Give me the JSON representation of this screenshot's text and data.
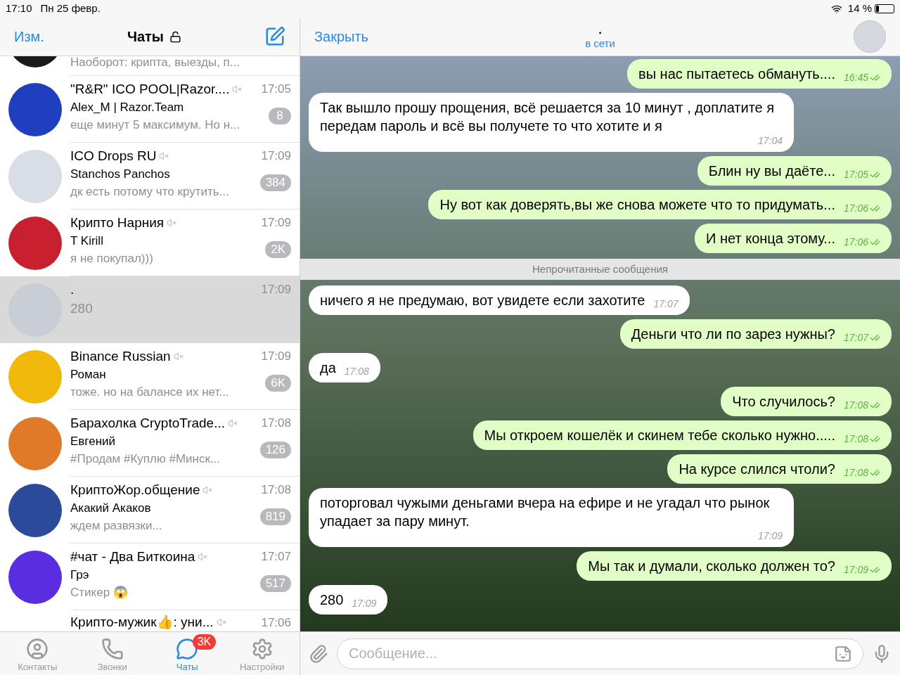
{
  "status_bar": {
    "time": "17:10",
    "date": "Пн 25 февр.",
    "battery": "14 %"
  },
  "chat_list": {
    "edit": "Изм.",
    "title": "Чаты",
    "locked": false,
    "chats": [
      {
        "kind": "top_partial",
        "preview": "Наоборот: крипта, выезды, п...",
        "color": "#1a1a1a"
      },
      {
        "kind": "full",
        "title": "\"R&R\" ICO POOL|Razor....",
        "muted": true,
        "time": "17:05",
        "sender": "Alex_M | Razor.Team",
        "preview": "еще минут 5 максимум. Но н...",
        "badge": "8",
        "selected": false,
        "color": "#1f3fbf"
      },
      {
        "kind": "full",
        "title": "ICO Drops RU",
        "muted": true,
        "time": "17:09",
        "sender": "Stanchos Panchos",
        "preview": "дк есть потому что крутить...",
        "badge": "384",
        "selected": false,
        "color": "#d9dde6"
      },
      {
        "kind": "full",
        "title": "Крипто Нарния",
        "muted": true,
        "time": "17:09",
        "sender": "T Kirill",
        "preview": "я не покупал)))",
        "badge": "2K",
        "selected": false,
        "color": "#c8202e"
      },
      {
        "kind": "full",
        "title": ".",
        "muted": false,
        "time": "17:09",
        "preview": "280",
        "selected": true,
        "color": "#c9ced6"
      },
      {
        "kind": "full",
        "title": "Binance Russian",
        "muted": true,
        "time": "17:09",
        "sender": "Роман",
        "preview": "тоже. но на балансе их нет...",
        "badge": "6K",
        "selected": false,
        "color": "#f0b90b"
      },
      {
        "kind": "full",
        "title": "Барахолка CryptoTrade...",
        "muted": true,
        "time": "17:08",
        "sender": "Евгений",
        "preview": "#Продам #Куплю  #Минск...",
        "badge": "126",
        "selected": false,
        "color": "#e07a28"
      },
      {
        "kind": "full",
        "title": "КриптоЖор.общение",
        "muted": true,
        "time": "17:08",
        "sender": "Акакий Акаков",
        "preview": "ждем развязки...",
        "badge": "819",
        "selected": false,
        "color": "#2b4a9a"
      },
      {
        "kind": "full",
        "title": "#чат - Два Биткоина",
        "muted": true,
        "time": "17:07",
        "sender": "Грэ",
        "preview": "Стикер 😱",
        "badge": "517",
        "selected": false,
        "color": "#5b2de0"
      },
      {
        "kind": "bottom_partial",
        "title": "Крипто-мужик👍: уни...",
        "muted": true,
        "time": "17:06"
      }
    ]
  },
  "tab_bar": [
    {
      "kind": "contacts",
      "label": "Контакты",
      "selected": false
    },
    {
      "kind": "calls",
      "label": "Звонки",
      "selected": false
    },
    {
      "kind": "chats",
      "label": "Чаты",
      "selected": true,
      "badge": "3K"
    },
    {
      "kind": "settings",
      "label": "Настройки",
      "selected": false
    }
  ],
  "chat": {
    "close": "Закрыть",
    "title": ".",
    "status": "в сети",
    "messages": [
      {
        "kind": "out",
        "text": "вы нас пытаетесь обмануть....",
        "time": "16:45",
        "read": true
      },
      {
        "kind": "in",
        "text": "Так вышло прошу прощения, всё решается за 10 минут , доплатите я передам пароль и всё вы получете то что хотите и я",
        "time": "17:04"
      },
      {
        "kind": "out",
        "text": "Блин ну вы даёте...",
        "time": "17:05",
        "read": true
      },
      {
        "kind": "out",
        "text": "Ну вот как доверять,вы же снова можете что то придумать...",
        "time": "17:06",
        "read": true
      },
      {
        "kind": "out",
        "text": "И нет конца этому...",
        "time": "17:06",
        "read": true
      },
      {
        "kind": "divider",
        "text": "Непрочитанные сообщения"
      },
      {
        "kind": "in",
        "text": "ничего я не предумаю, вот увидете если захотите",
        "time": "17:07"
      },
      {
        "kind": "out",
        "text": "Деньги что ли по зарез нужны?",
        "time": "17:07",
        "read": true
      },
      {
        "kind": "in",
        "text": "да",
        "time": "17:08"
      },
      {
        "kind": "out",
        "text": "Что случилось?",
        "time": "17:08",
        "read": true
      },
      {
        "kind": "out",
        "text": "Мы откроем кошелёк и скинем тебе сколько нужно.....",
        "time": "17:08",
        "read": true
      },
      {
        "kind": "out",
        "text": "На курсе слился чтоли?",
        "time": "17:08",
        "read": true
      },
      {
        "kind": "in",
        "text": "поторговал чужыми деньгами вчера на ефире и не угадал что рынок упадает за пару минут.",
        "time": "17:09"
      },
      {
        "kind": "out",
        "text": "Мы так и думали, сколько должен то?",
        "time": "17:09",
        "read": true
      },
      {
        "kind": "in",
        "text": "280",
        "time": "17:09"
      }
    ],
    "input": {
      "placeholder": "Сообщение..."
    }
  }
}
